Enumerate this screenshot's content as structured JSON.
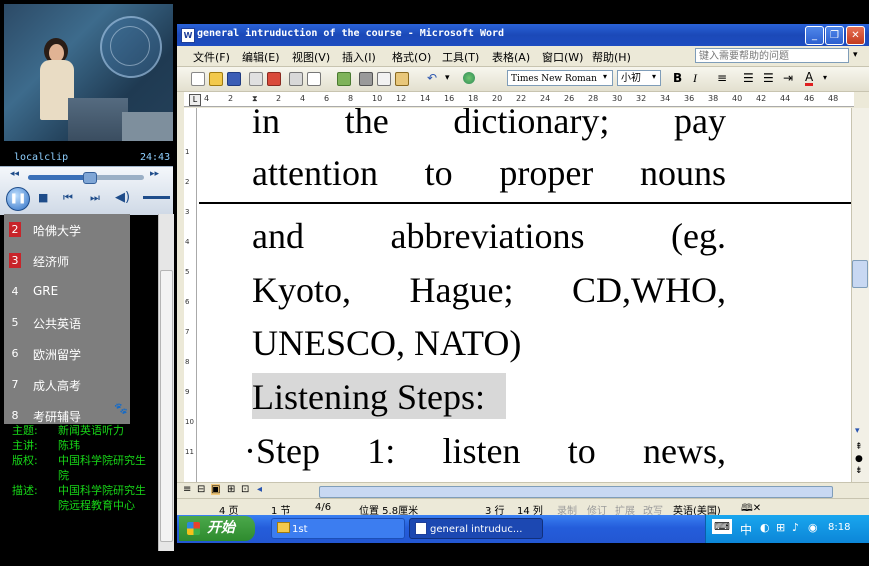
{
  "player": {
    "clip_name": "localclip",
    "clip_time": "24:43",
    "seek_progress": 0.53,
    "playlist": [
      {
        "num": "2",
        "label": "哈佛大学",
        "highlight": true
      },
      {
        "num": "3",
        "label": "经济师",
        "highlight": true
      },
      {
        "num": "4",
        "label": "GRE",
        "highlight": false
      },
      {
        "num": "5",
        "label": "公共英语",
        "highlight": false
      },
      {
        "num": "6",
        "label": "欧洲留学",
        "highlight": false
      },
      {
        "num": "7",
        "label": "成人高考",
        "highlight": false
      },
      {
        "num": "8",
        "label": "考研辅导",
        "highlight": false
      }
    ],
    "info": [
      {
        "key": "主题:",
        "value": "新闻英语听力"
      },
      {
        "key": "主讲:",
        "value": "陈玮"
      },
      {
        "key": "版权:",
        "value": "中国科学院研究生院"
      },
      {
        "key": "描述:",
        "value": "中国科学院研究生院远程教育中心"
      }
    ]
  },
  "word": {
    "title": "general intruduction of the course - Microsoft Word",
    "menu": [
      "文件(F)",
      "编辑(E)",
      "视图(V)",
      "插入(I)",
      "格式(O)",
      "工具(T)",
      "表格(A)",
      "窗口(W)",
      "帮助(H)"
    ],
    "help_placeholder": "键入需要帮助的问题",
    "font_name": "Times New Roman",
    "font_size": "小初",
    "ruler_marks": [
      "4",
      "2",
      "",
      "2",
      "4",
      "6",
      "8",
      "10",
      "12",
      "14",
      "16",
      "18",
      "20",
      "22",
      "24",
      "26",
      "28",
      "30",
      "32",
      "34",
      "36",
      "38",
      "40",
      "42",
      "44",
      "46",
      "48"
    ],
    "doc_lines": [
      "in the dictionary; pay",
      "attention to proper nouns",
      "and abbreviations (eg.",
      "Kyoto, Hague; CD,WHO,",
      "UNESCO, NATO)",
      "Listening Steps:",
      "·Step 1: listen to news,"
    ],
    "status": {
      "page": "4 页",
      "section": "1 节",
      "pages": "4/6",
      "position": "位置 5.8厘米",
      "line": "3 行",
      "col": "14 列",
      "rec": "录制",
      "trk": "修订",
      "ext": "扩展",
      "ovr": "改写",
      "lang": "英语(美国)"
    }
  },
  "taskbar": {
    "start_label": "开始",
    "tasks": [
      "1st",
      "general intruduc..."
    ],
    "ime": "中",
    "clock": "8:18"
  }
}
